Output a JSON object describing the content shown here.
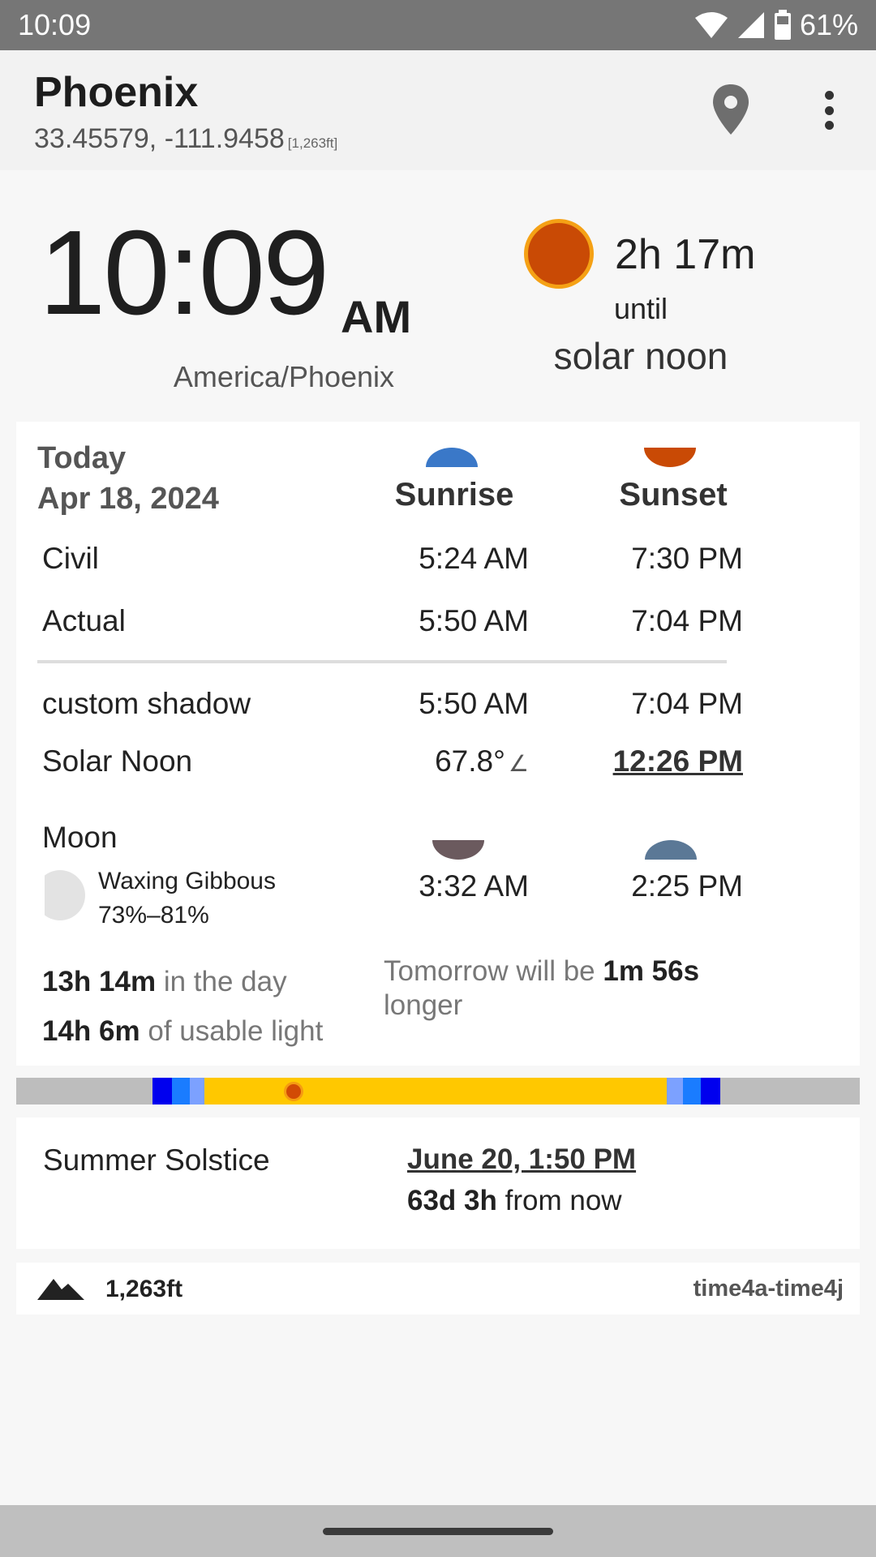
{
  "status_bar": {
    "time": "10:09",
    "battery": "61%",
    "icons": [
      "wifi-icon",
      "signal-icon",
      "battery-icon"
    ]
  },
  "app_bar": {
    "title": "Phoenix",
    "coords": "33.45579, -111.9458",
    "altitude": "[1,263ft]",
    "icons": [
      "location-pin-icon",
      "more-vert-icon"
    ]
  },
  "clock": {
    "time": "10:09",
    "ampm": "AM",
    "timezone": "America/Phoenix"
  },
  "countdown": {
    "value": "2h 17m",
    "until": "until",
    "event": "solar noon"
  },
  "today": {
    "label": "Today",
    "date": "Apr 18, 2024",
    "headers": {
      "sunrise": "Sunrise",
      "sunset": "Sunset"
    },
    "rows": [
      {
        "label": "Civil",
        "rise": "5:24 AM",
        "set": "7:30 PM"
      },
      {
        "label": "Actual",
        "rise": "5:50 AM",
        "set": "7:04 PM"
      },
      {
        "label": "custom shadow",
        "rise": "5:50 AM",
        "set": "7:04 PM"
      }
    ],
    "solar_noon": {
      "label": "Solar Noon",
      "angle": "67.8°",
      "angle_icon": "∠",
      "time": "12:26 PM"
    }
  },
  "moon": {
    "label": "Moon",
    "phase": "Waxing Gibbous",
    "illumination": "73%–81%",
    "rise": "3:32 AM",
    "set": "2:25 PM"
  },
  "daylight": {
    "day_length": "13h 14m",
    "day_suffix": "in the day",
    "usable_light": "14h 6m",
    "usable_suffix": "of usable light",
    "tomorrow_prefix": "Tomorrow will be",
    "tomorrow_diff": "1m 56s",
    "tomorrow_suffix": "longer"
  },
  "day_bar": {
    "current_time_fraction": 0.329
  },
  "solstice": {
    "label": "Summer Solstice",
    "date": "June 20, 1:50 PM",
    "remaining": "63d 3h",
    "remaining_suffix": "from now"
  },
  "footer": {
    "altitude": "1,263ft",
    "provider": "time4a-time4j"
  },
  "colors": {
    "status_bar": "#767676",
    "sunrise_icon": "#3a78c8",
    "sunset_icon": "#c94a05",
    "moonrise_icon": "#6b5a5e",
    "moonset_icon": "#5b7896",
    "day": "#ffc800",
    "night": "#bdbdbd",
    "astronomical": "#0000ee",
    "nautical": "#1a7cff",
    "civil": "#7ca1ff"
  }
}
